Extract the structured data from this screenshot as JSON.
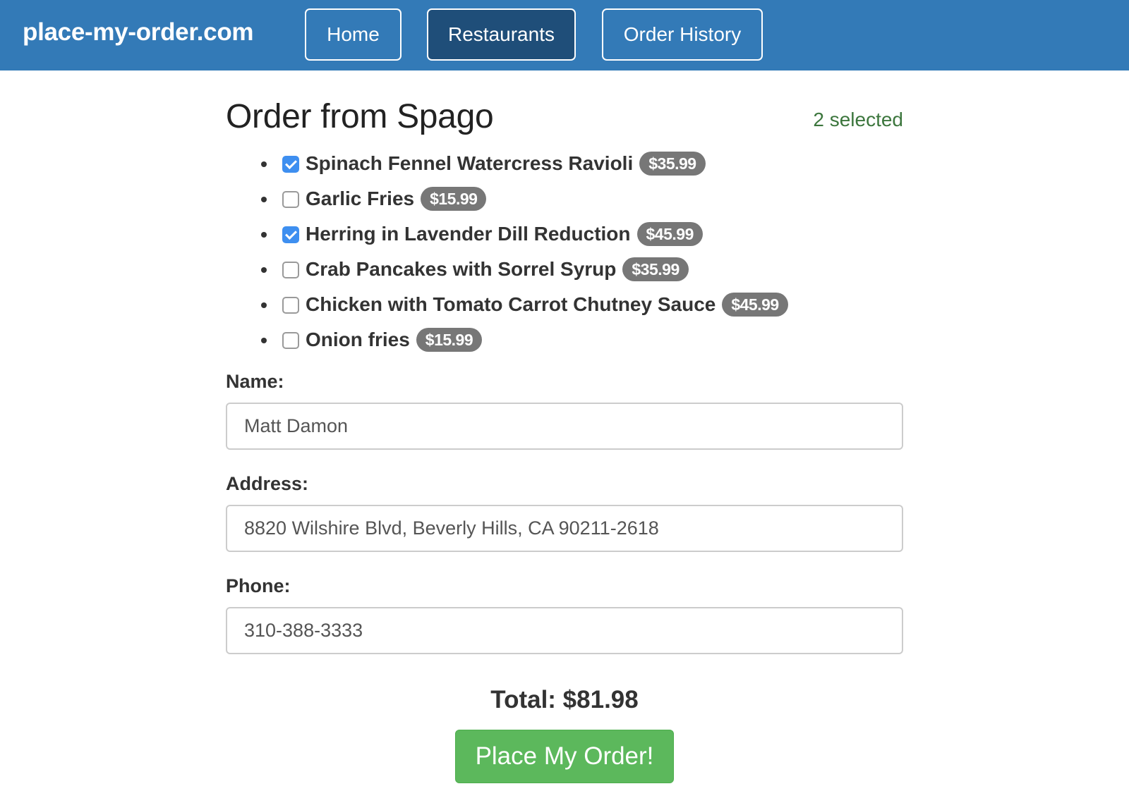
{
  "navbar": {
    "brand": "place-my-order.com",
    "links": [
      {
        "label": "Home",
        "active": false
      },
      {
        "label": "Restaurants",
        "active": true
      },
      {
        "label": "Order History",
        "active": false
      }
    ]
  },
  "order": {
    "title": "Order from Spago",
    "selected_count": "2 selected",
    "items": [
      {
        "name": "Spinach Fennel Watercress Ravioli",
        "price": "$35.99",
        "checked": true
      },
      {
        "name": "Garlic Fries",
        "price": "$15.99",
        "checked": false
      },
      {
        "name": "Herring in Lavender Dill Reduction",
        "price": "$45.99",
        "checked": true
      },
      {
        "name": "Crab Pancakes with Sorrel Syrup",
        "price": "$35.99",
        "checked": false
      },
      {
        "name": "Chicken with Tomato Carrot Chutney Sauce",
        "price": "$45.99",
        "checked": false
      },
      {
        "name": "Onion fries",
        "price": "$15.99",
        "checked": false
      }
    ]
  },
  "form": {
    "name_label": "Name:",
    "name_value": "Matt Damon",
    "address_label": "Address:",
    "address_value": "8820 Wilshire Blvd, Beverly Hills, CA 90211-2618",
    "phone_label": "Phone:",
    "phone_value": "310-388-3333"
  },
  "total": "Total: $81.98",
  "place_order_label": "Place My Order!",
  "colors": {
    "navbar": "#337ab7",
    "nav_active": "#1f4e79",
    "selected_text": "#3c763d",
    "badge": "#777777",
    "checkbox_checked": "#3e8ff0",
    "place_order_button": "#5cb85c"
  }
}
